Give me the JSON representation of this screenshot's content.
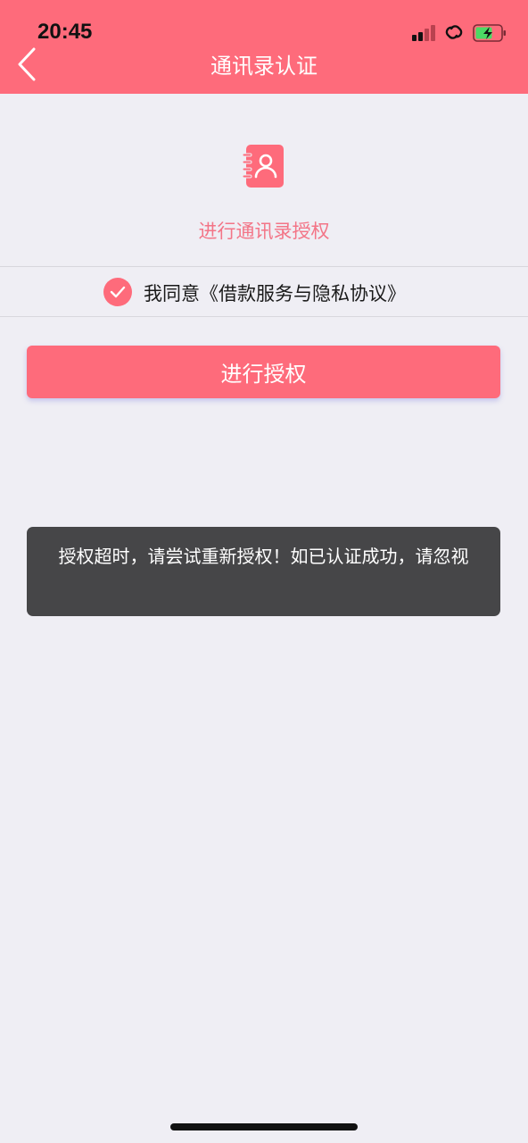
{
  "status_bar": {
    "time": "20:45",
    "icons": [
      "cellular-signal-icon",
      "link-icon",
      "battery-charging-icon"
    ],
    "battery_color": "#4cd964"
  },
  "nav": {
    "back_icon": "chevron-left-icon",
    "title": "通讯录认证"
  },
  "main": {
    "contact_icon": "contact-book-icon",
    "auth_label": "进行通讯录授权",
    "agreement": {
      "checked": true,
      "text": "我同意《借款服务与隐私协议》"
    },
    "authorize_button": "进行授权"
  },
  "toast": {
    "message": "授权超时，请尝试重新授权！如已认证成功，请忽视"
  },
  "colors": {
    "brand": "#fe6b7b",
    "background": "#efeef4",
    "label_pink": "#f37587",
    "toast_bg": "#464648"
  }
}
